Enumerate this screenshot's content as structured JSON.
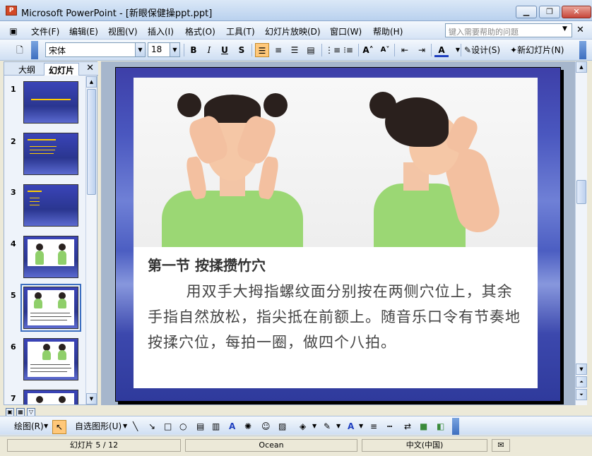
{
  "window": {
    "title": "Microsoft PowerPoint - [新眼保健操ppt.ppt]",
    "minimize": "▁",
    "restore": "❐",
    "close": "✕"
  },
  "menu": {
    "items": [
      "文件(F)",
      "编辑(E)",
      "视图(V)",
      "插入(I)",
      "格式(O)",
      "工具(T)",
      "幻灯片放映(D)",
      "窗口(W)",
      "帮助(H)"
    ],
    "help_placeholder": "键入需要帮助的问题"
  },
  "toolbar": {
    "font_name": "宋体",
    "font_size": "18",
    "bold": "B",
    "italic": "I",
    "underline": "U",
    "shadow": "S",
    "design_label": "设计(S)",
    "new_slide_label": "新幻灯片(N)"
  },
  "panel": {
    "tab_outline": "大纲",
    "tab_slides": "幻灯片",
    "close": "✕",
    "slide_numbers": [
      "1",
      "2",
      "3",
      "4",
      "5",
      "6",
      "7"
    ],
    "selected_slide": "5"
  },
  "slide": {
    "heading": "第一节  按揉攒竹穴",
    "body": "用双手大拇指螺纹面分别按在两侧穴位上，其余手指自然放松，指尖抵在前额上。随音乐口令有节奏地按揉穴位，每拍一圈，做四个八拍。"
  },
  "drawbar": {
    "draw_label": "绘图(R)",
    "autoshape_label": "自选图形(U)"
  },
  "status": {
    "slide_info": "幻灯片 5 / 12",
    "theme": "Ocean",
    "language": "中文(中国)"
  },
  "colors": {
    "slide_bg": "#3d3fa8",
    "accent_selected": "#3d6fc0",
    "active_button": "#ffc87a"
  }
}
